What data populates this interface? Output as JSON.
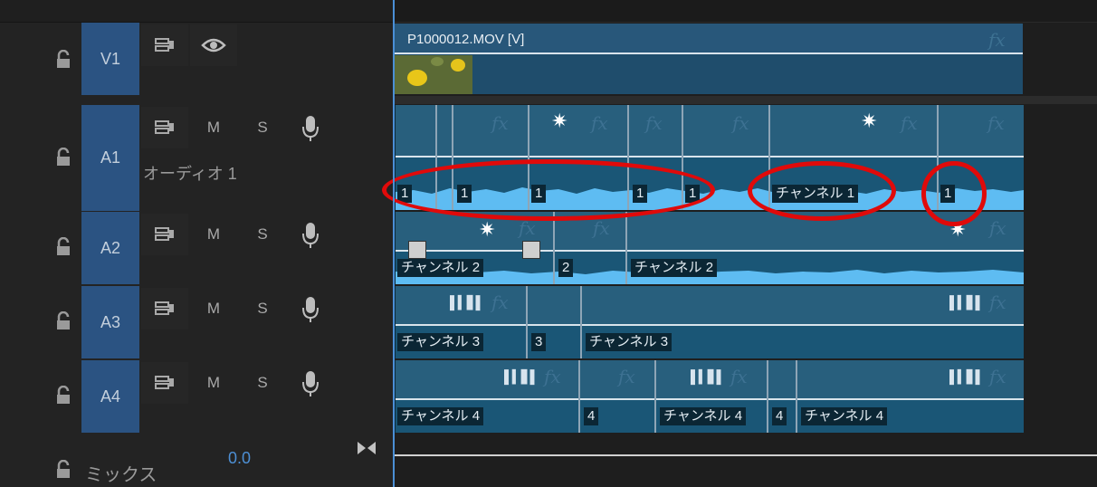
{
  "tracks": {
    "v1": {
      "name": "V1"
    },
    "a1": {
      "name": "A1",
      "title": "オーディオ 1",
      "mute": "M",
      "solo": "S"
    },
    "a2": {
      "name": "A2",
      "mute": "M",
      "solo": "S"
    },
    "a3": {
      "name": "A3",
      "mute": "M",
      "solo": "S"
    },
    "a4": {
      "name": "A4",
      "mute": "M",
      "solo": "S"
    },
    "mix": {
      "label": "ミックス",
      "value": "0.0"
    }
  },
  "clips": {
    "video": {
      "title": "P1000012.MOV [V]",
      "fx": "fx"
    },
    "fx": "fx",
    "a1": [
      "1",
      "1",
      "1",
      "1",
      "1",
      "チャンネル 1",
      "1"
    ],
    "a2": [
      "チャンネル 2",
      "2",
      "チャンネル 2"
    ],
    "a3": [
      "チャンネル 3",
      "3",
      "チャンネル 3"
    ],
    "a4": [
      "チャンネル 4",
      "4",
      "チャンネル 4",
      "4",
      "チャンネル 4"
    ]
  },
  "colors": {
    "track_name_bg": "#2b5382",
    "audio_clip": "#1a5676",
    "waveform": "#5ebcf2",
    "playhead": "#4a8fd6",
    "annotation": "#e00a0a"
  }
}
